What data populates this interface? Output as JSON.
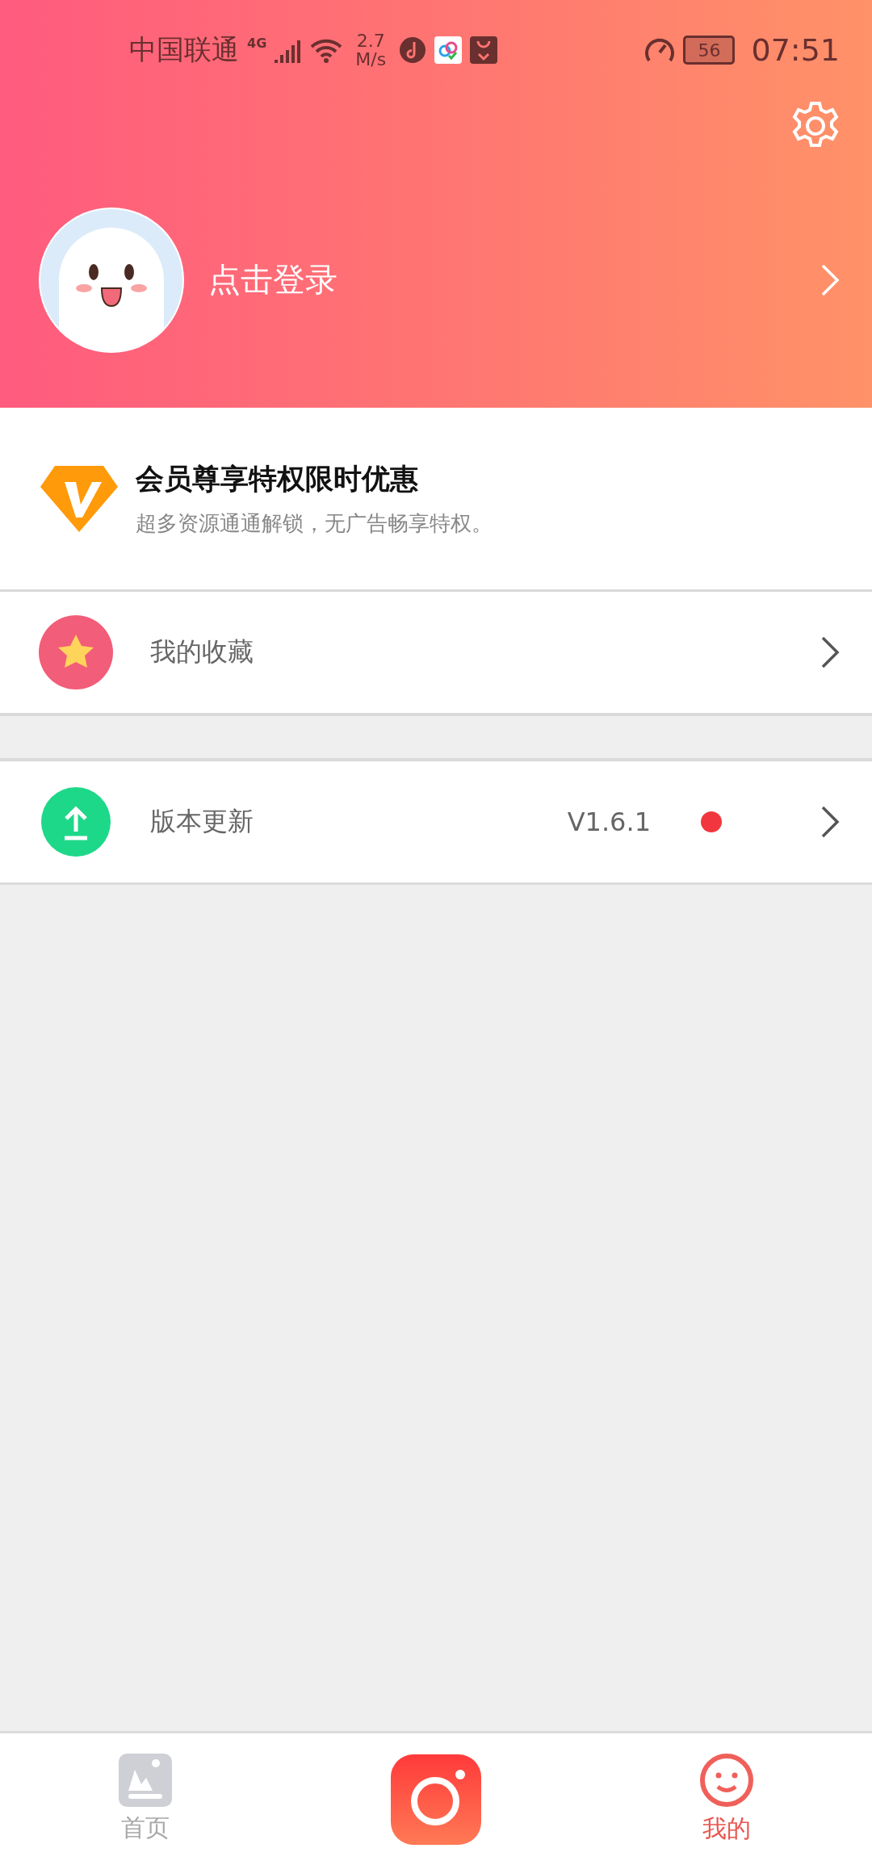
{
  "status_bar": {
    "carrier": "中国联通",
    "network": "4G",
    "speed_value": "2.7",
    "speed_unit": "M/s",
    "battery": "56",
    "time": "07:51"
  },
  "profile": {
    "login_label": "点击登录"
  },
  "vip": {
    "title": "会员尊享特权限时优惠",
    "subtitle": "超多资源通通解锁，无广告畅享特权。"
  },
  "menu": [
    {
      "kind": "favorites",
      "label": "我的收藏"
    },
    {
      "kind": "update",
      "label": "版本更新",
      "value": "V1.6.1",
      "badge": true
    }
  ],
  "tab_bar": [
    {
      "kind": "home",
      "label": "首页",
      "selected": false
    },
    {
      "kind": "camera",
      "selected": false
    },
    {
      "kind": "mine",
      "label": "我的",
      "selected": true
    }
  ]
}
